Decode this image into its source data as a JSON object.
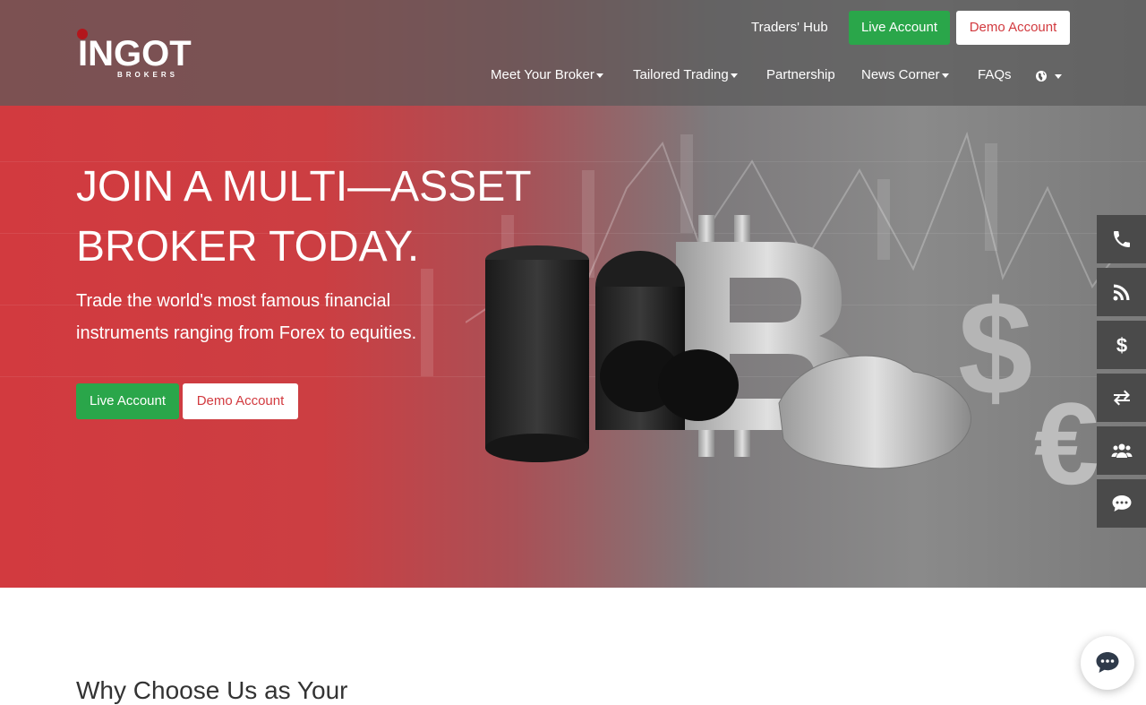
{
  "brand": {
    "name": "INGOT",
    "tagline": "BROKERS"
  },
  "header": {
    "traders_hub": "Traders' Hub",
    "live_account": "Live Account",
    "demo_account": "Demo Account",
    "nav": [
      {
        "label": "Meet Your Broker",
        "dropdown": true
      },
      {
        "label": "Tailored Trading",
        "dropdown": true
      },
      {
        "label": "Partnership",
        "dropdown": false
      },
      {
        "label": "News Corner",
        "dropdown": true
      },
      {
        "label": "FAQs",
        "dropdown": false
      }
    ],
    "language_icon": "globe-icon"
  },
  "hero": {
    "headline_line1": "JOIN A MULTI—ASSET",
    "headline_line2": "BROKER TODAY.",
    "subheadline_line1": "Trade the world's most famous financial",
    "subheadline_line2": "instruments ranging from Forex to equities.",
    "live_account": "Live Account",
    "demo_account": "Demo Account"
  },
  "side_dock": [
    {
      "icon": "phone-icon"
    },
    {
      "icon": "rss-icon"
    },
    {
      "icon": "dollar-icon"
    },
    {
      "icon": "exchange-icon"
    },
    {
      "icon": "users-icon"
    },
    {
      "icon": "chat-icon"
    }
  ],
  "section": {
    "heading": "Why Choose Us as Your"
  },
  "colors": {
    "brand_red": "#d23a3f",
    "live_green": "#2aa64a",
    "dock_bg": "#4a4a4a"
  }
}
